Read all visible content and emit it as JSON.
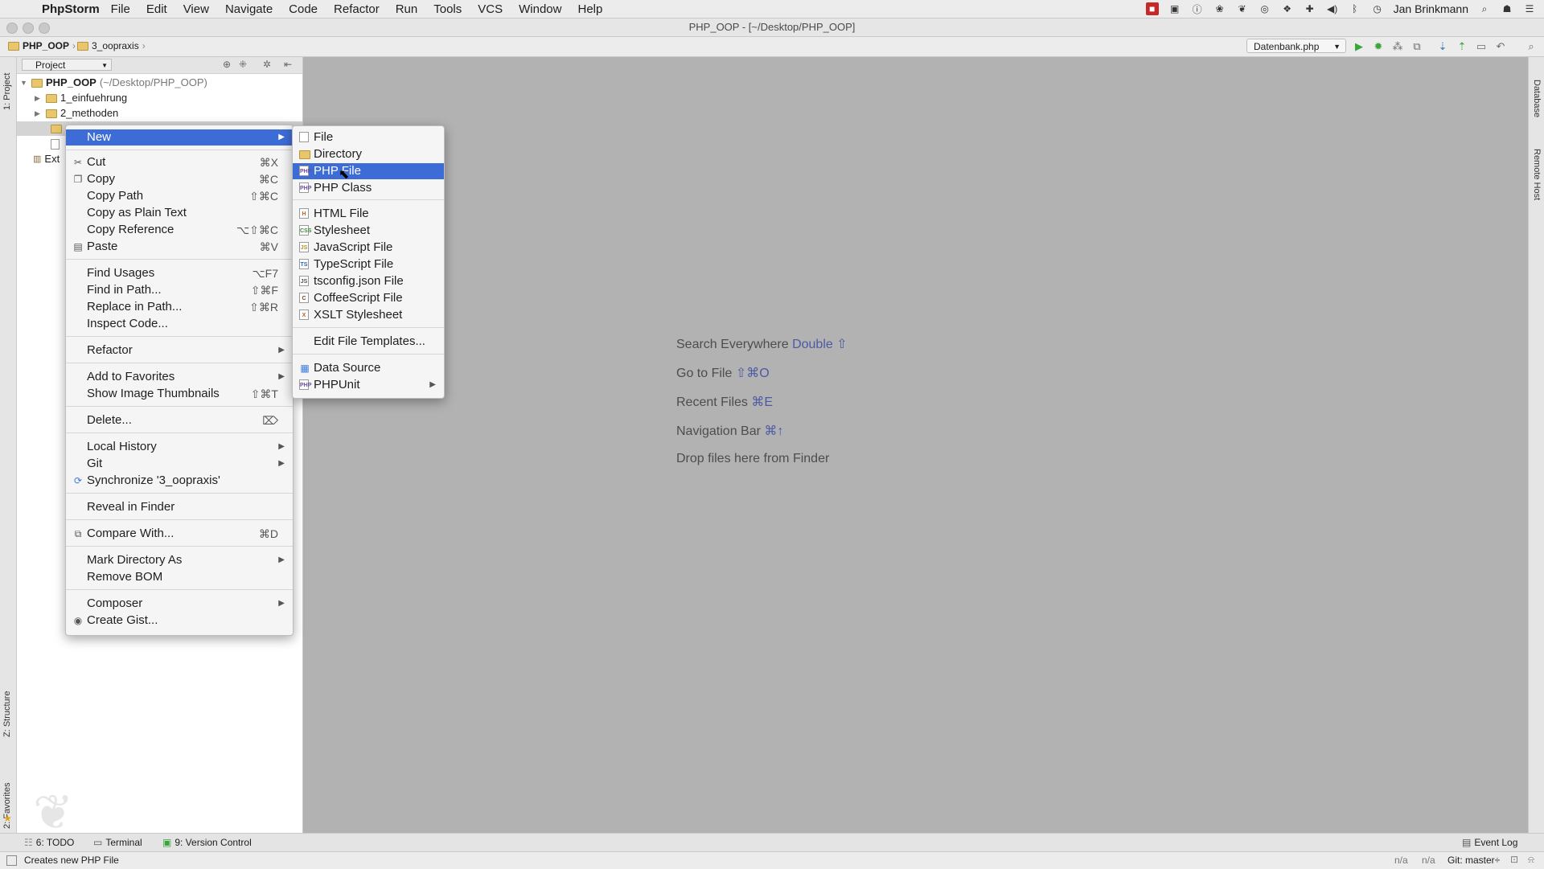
{
  "menubar": {
    "app": "PhpStorm",
    "items": [
      "File",
      "Edit",
      "View",
      "Navigate",
      "Code",
      "Refactor",
      "Run",
      "Tools",
      "VCS",
      "Window",
      "Help"
    ],
    "user": "Jan Brinkmann"
  },
  "window": {
    "title": "PHP_OOP - [~/Desktop/PHP_OOP]"
  },
  "navbar": {
    "crumbs": [
      "PHP_OOP",
      "3_oopraxis"
    ],
    "run_config": "Datenbank.php"
  },
  "tool_windows": {
    "left_top": "1: Project",
    "left_structure": "Z: Structure",
    "left_favorites": "2: Favorites",
    "right_database": "Database",
    "right_remote": "Remote Host"
  },
  "project": {
    "header": "Project",
    "root_name": "PHP_OOP",
    "root_path": "(~/Desktop/PHP_OOP)",
    "items": [
      "1_einfuehrung",
      "2_methoden"
    ],
    "external": "Ext"
  },
  "context_menu": {
    "groups": [
      [
        {
          "label": "New"
        }
      ],
      [
        {
          "label": "Cut",
          "shortcut": "⌘X"
        },
        {
          "label": "Copy",
          "shortcut": "⌘C"
        },
        {
          "label": "Copy Path",
          "shortcut": "⇧⌘C"
        },
        {
          "label": "Copy as Plain Text",
          "shortcut": ""
        },
        {
          "label": "Copy Reference",
          "shortcut": "⌥⇧⌘C"
        },
        {
          "label": "Paste",
          "shortcut": "⌘V"
        }
      ],
      [
        {
          "label": "Find Usages",
          "shortcut": "⌥F7"
        },
        {
          "label": "Find in Path...",
          "shortcut": "⇧⌘F"
        },
        {
          "label": "Replace in Path...",
          "shortcut": "⇧⌘R"
        },
        {
          "label": "Inspect Code...",
          "shortcut": ""
        }
      ],
      [
        {
          "label": "Refactor"
        }
      ],
      [
        {
          "label": "Add to Favorites"
        },
        {
          "label": "Show Image Thumbnails",
          "shortcut": "⇧⌘T"
        }
      ],
      [
        {
          "label": "Delete...",
          "shortcut": "⌦"
        }
      ],
      [
        {
          "label": "Local History"
        },
        {
          "label": "Git"
        },
        {
          "label": "Synchronize '3_oopraxis'"
        }
      ],
      [
        {
          "label": "Reveal in Finder"
        }
      ],
      [
        {
          "label": "Compare With...",
          "shortcut": "⌘D"
        }
      ],
      [
        {
          "label": "Mark Directory As"
        },
        {
          "label": "Remove BOM"
        }
      ],
      [
        {
          "label": "Composer"
        },
        {
          "label": "Create Gist..."
        }
      ]
    ]
  },
  "new_submenu": {
    "groups": [
      [
        "File",
        "Directory",
        "PHP File",
        "PHP Class"
      ],
      [
        "HTML File",
        "Stylesheet",
        "JavaScript File",
        "TypeScript File",
        "tsconfig.json File",
        "CoffeeScript File",
        "XSLT Stylesheet"
      ],
      [
        "Edit File Templates..."
      ],
      [
        "Data Source",
        "PHPUnit"
      ]
    ],
    "selected": "PHP File"
  },
  "editor_hints": [
    {
      "text": "Search Everywhere",
      "key": "Double ⇧"
    },
    {
      "text": "Go to File",
      "key": "⇧⌘O"
    },
    {
      "text": "Recent Files",
      "key": "⌘E"
    },
    {
      "text": "Navigation Bar",
      "key": "⌘↑"
    },
    {
      "text": "Drop files here from Finder",
      "key": ""
    }
  ],
  "bottom_tools": [
    "6: TODO",
    "Terminal",
    "9: Version Control"
  ],
  "event_log": "Event Log",
  "status": {
    "message": "Creates new PHP File",
    "pos1": "n/a",
    "pos2": "n/a",
    "git": "Git: master÷"
  }
}
